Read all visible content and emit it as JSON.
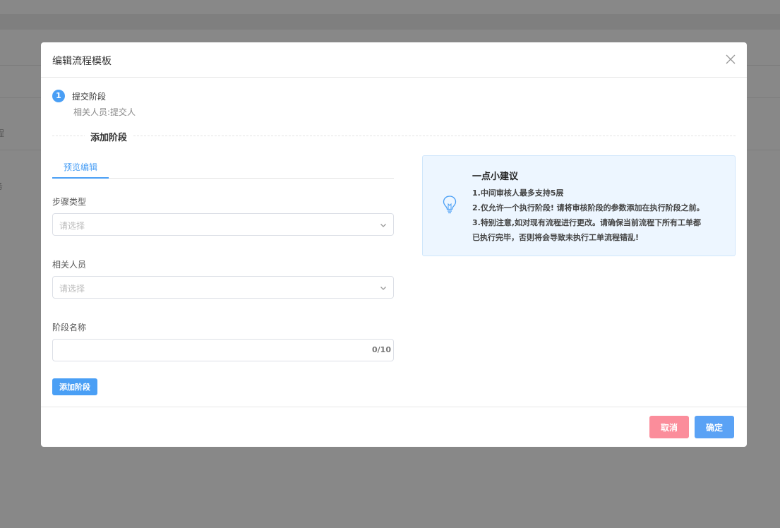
{
  "background": {
    "fragments": [
      "程",
      "务"
    ]
  },
  "modal": {
    "title": "编辑流程模板",
    "step": {
      "number": "1",
      "title": "提交阶段",
      "description": "相关人员:提交人"
    },
    "divider_label": "添加阶段",
    "tab_label": "预览编辑",
    "fields": {
      "step_type": {
        "label": "步骤类型",
        "placeholder": "请选择"
      },
      "related_people": {
        "label": "相关人员",
        "placeholder": "请选择"
      },
      "stage_name": {
        "label": "阶段名称",
        "value": "",
        "counter": "0/10"
      }
    },
    "add_stage_button": "添加阶段",
    "tip": {
      "title": "一点小建议",
      "lines": [
        "1.中间审核人最多支持5层",
        "2.仅允许一个执行阶段! 请将审核阶段的参数添加在执行阶段之前。",
        "3.特别注意,如对现有流程进行更改。请确保当前流程下所有工单都",
        "已执行完毕，否则将会导致未执行工单流程错乱!"
      ]
    },
    "footer": {
      "cancel": "取消",
      "confirm": "确定"
    }
  },
  "colors": {
    "accent": "#4a9ff5",
    "cancel": "#fb8d9b",
    "tip_background": "#edf6ff",
    "overlay": "#888888"
  }
}
